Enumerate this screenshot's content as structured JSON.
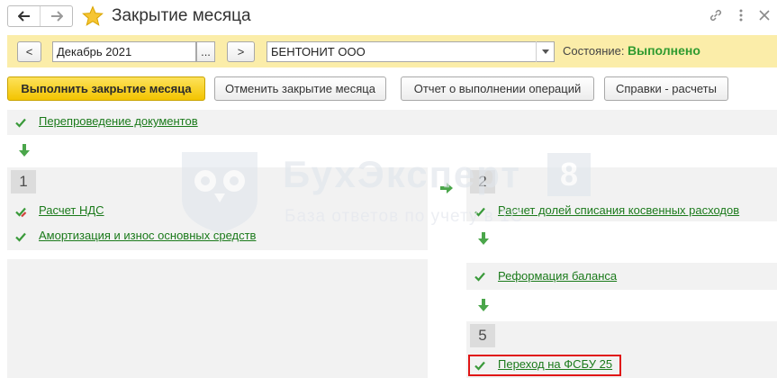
{
  "window": {
    "title": "Закрытие месяца",
    "icons": [
      "back-arrow-icon",
      "forward-arrow-icon",
      "favorite-star-icon",
      "link-icon",
      "more-icon",
      "close-icon"
    ]
  },
  "params": {
    "prev_label": "<",
    "period": "Декабрь 2021",
    "period_picker": "...",
    "next_label": ">",
    "organization": "БЕНТОНИТ ООО",
    "state_label": "Состояние:",
    "state_value": "Выполнено"
  },
  "toolbar": {
    "run": "Выполнить закрытие месяца",
    "cancel": "Отменить закрытие месяца",
    "report": "Отчет о выполнении операций",
    "calcs": "Справки - расчеты"
  },
  "watermark": {
    "brand": "БухЭксперт",
    "digit": "8",
    "tagline": "База ответов по учету в 1С"
  },
  "flow": {
    "repost": "Перепроведение документов",
    "group1": {
      "number": "1",
      "items": [
        "Расчет НДС",
        "Амортизация и износ основных средств"
      ]
    },
    "group2": {
      "number": "2",
      "items": [
        "Расчет долей списания косвенных расходов"
      ]
    },
    "reform": "Реформация баланса",
    "group5": {
      "number": "5",
      "items": [
        "Переход на ФСБУ 25"
      ]
    }
  },
  "colors": {
    "accent_yellow": "#f3c400",
    "param_bar": "#fbeda9",
    "success_green": "#2f9b2f",
    "link_green": "#1b7a1b",
    "highlight_red": "#e01515"
  }
}
